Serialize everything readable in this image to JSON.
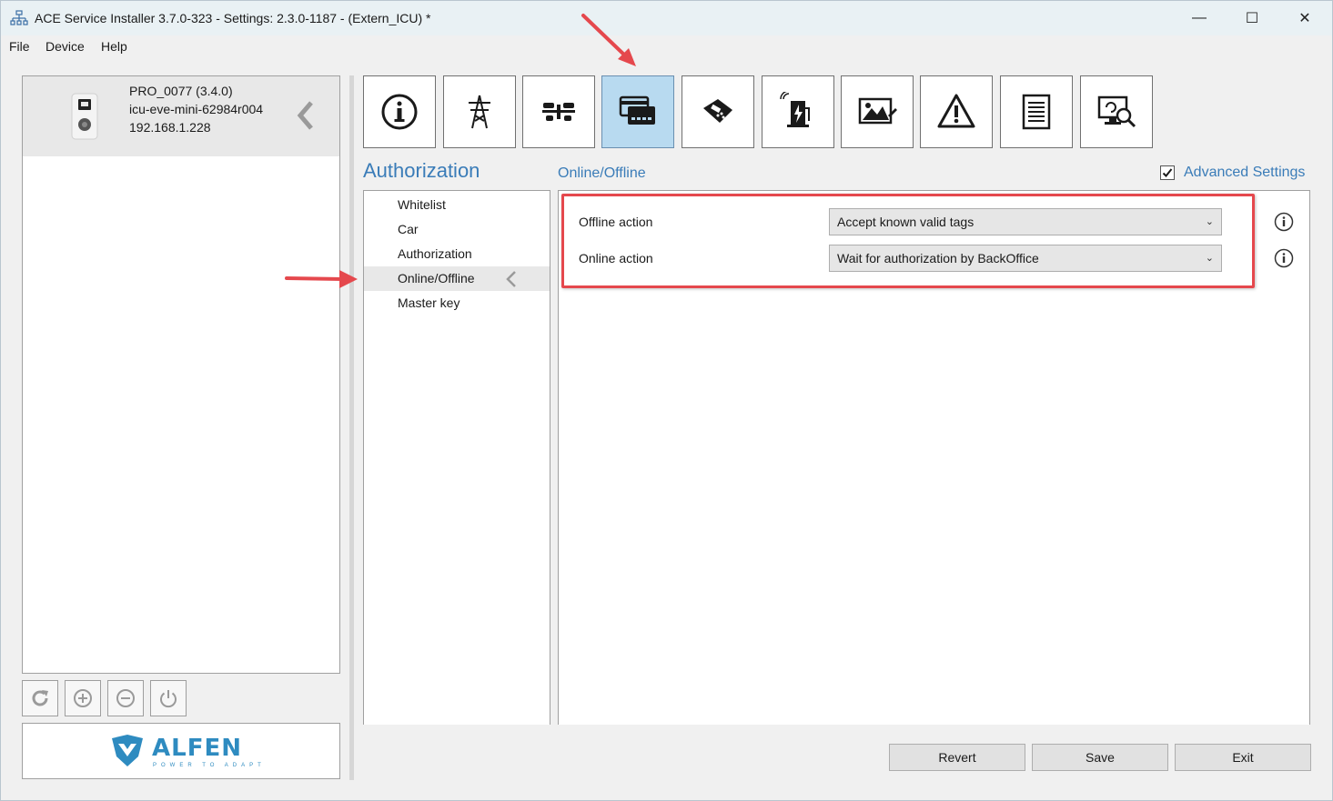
{
  "window": {
    "title": "ACE Service Installer 3.7.0-323 - Settings: 2.3.0-1187 -  (Extern_ICU) *",
    "controls": {
      "minimize": "—",
      "maximize": "☐",
      "close": "✕"
    }
  },
  "menu": {
    "items": [
      "File",
      "Device",
      "Help"
    ]
  },
  "device": {
    "name": "PRO_0077 (3.4.0)",
    "id": "icu-eve-mini-62984r004",
    "ip": "192.168.1.228"
  },
  "device_toolbar": [
    "refresh-icon",
    "add-icon",
    "remove-icon",
    "power-icon"
  ],
  "logo": {
    "brand": "ALFEN",
    "tagline": "POWER TO ADAPT"
  },
  "tabs": [
    {
      "icon": "info-icon"
    },
    {
      "icon": "power-grid-icon"
    },
    {
      "icon": "load-balancing-icon"
    },
    {
      "icon": "authorization-card-icon",
      "active": true
    },
    {
      "icon": "payment-terminal-icon"
    },
    {
      "icon": "charging-station-icon"
    },
    {
      "icon": "display-image-icon"
    },
    {
      "icon": "warning-icon"
    },
    {
      "icon": "document-icon"
    },
    {
      "icon": "monitor-diagnostics-icon"
    }
  ],
  "section": {
    "title": "Authorization"
  },
  "subsection": {
    "title": "Online/Offline"
  },
  "advanced_settings": {
    "label": "Advanced Settings",
    "checked": true
  },
  "nav": {
    "items": [
      {
        "label": "Whitelist"
      },
      {
        "label": "Car"
      },
      {
        "label": "Authorization"
      },
      {
        "label": "Online/Offline",
        "active": true
      },
      {
        "label": "Master key"
      }
    ]
  },
  "fields": {
    "offline": {
      "label": "Offline action",
      "value": "Accept known valid tags"
    },
    "online": {
      "label": "Online action",
      "value": "Wait for authorization by BackOffice"
    }
  },
  "footer": {
    "revert": "Revert",
    "save": "Save",
    "exit": "Exit"
  },
  "colors": {
    "accent": "#3a7cb8",
    "highlight": "#e5484d",
    "active_tab": "#b8daf0"
  }
}
